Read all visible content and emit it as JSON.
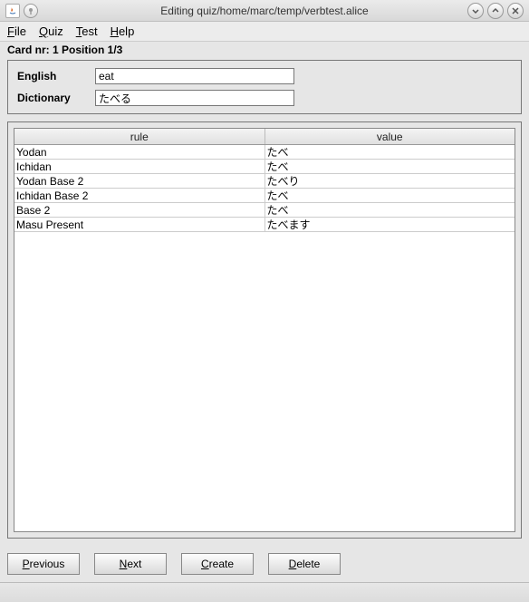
{
  "window": {
    "title": "Editing quiz/home/marc/temp/verbtest.alice"
  },
  "menu": {
    "file": "File",
    "quiz": "Quiz",
    "test": "Test",
    "help": "Help"
  },
  "status": "Card nr: 1 Position 1/3",
  "fields": {
    "english_label": "English",
    "english_value": "eat",
    "dictionary_label": "Dictionary",
    "dictionary_value": "たべる"
  },
  "table": {
    "headers": {
      "rule": "rule",
      "value": "value"
    },
    "rows": [
      {
        "rule": "Yodan",
        "value": "たべ"
      },
      {
        "rule": "Ichidan",
        "value": "たべ"
      },
      {
        "rule": "Yodan Base 2",
        "value": "たべり"
      },
      {
        "rule": "Ichidan Base 2",
        "value": "たべ"
      },
      {
        "rule": "Base 2",
        "value": "たべ"
      },
      {
        "rule": "Masu Present",
        "value": "たべます"
      }
    ]
  },
  "buttons": {
    "previous": "Previous",
    "next": "Next",
    "create": "Create",
    "delete": "Delete"
  }
}
